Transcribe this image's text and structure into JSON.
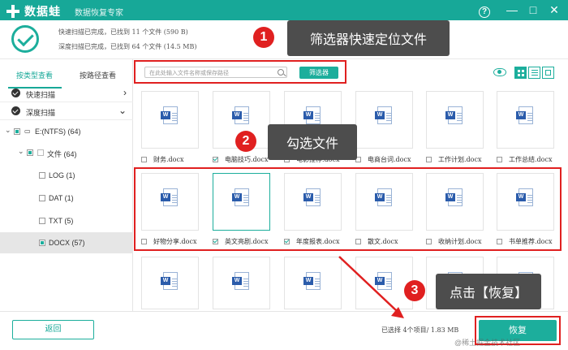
{
  "titlebar": {
    "app_name": "数据蛙",
    "subtitle": "数据恢复专家",
    "help": "?",
    "minimize": "—",
    "maximize": "□",
    "close": "✕"
  },
  "scan": {
    "quick_line": "快速扫描已完成，已找到 11 个文件 (590 B)",
    "deep_line": "深度扫描已完成，已找到 64 个文件 (14.5 MB)"
  },
  "annotations": {
    "badge1": "1",
    "callout1": "筛选器快速定位文件",
    "badge2": "2",
    "callout2": "勾选文件",
    "badge3": "3",
    "callout3": "点击【恢复】",
    "highlight_color": "#e02020"
  },
  "sidebar": {
    "tab_by_type": "按类型查看",
    "tab_by_path": "按路径查看",
    "quick_scan": "快速扫描",
    "quick_scan_arrow": "›",
    "deep_scan": "深度扫描",
    "deep_scan_arrow": "⌄",
    "tree": {
      "drive": "E:(NTFS) (64)",
      "folder": "文件 (64)",
      "items": [
        "LOG (1)",
        "DAT (1)",
        "TXT (5)",
        "DOCX (57)"
      ]
    }
  },
  "toolbar": {
    "search_placeholder": "在此处输入文件名称或保存路径",
    "filter_button": "筛选器"
  },
  "files": {
    "row1": [
      {
        "name": "财务.docx",
        "checked": false
      },
      {
        "name": "电脑技巧.docx",
        "checked": true
      },
      {
        "name": "电影推荐.docx",
        "checked": false
      },
      {
        "name": "电商台词.docx",
        "checked": false
      },
      {
        "name": "工作计划.docx",
        "checked": false
      },
      {
        "name": "工作总结.docx",
        "checked": false
      }
    ],
    "row2": [
      {
        "name": "好物分享.docx",
        "checked": false
      },
      {
        "name": "英文亮剧.docx",
        "checked": true
      },
      {
        "name": "年度报表.docx",
        "checked": true
      },
      {
        "name": "散文.docx",
        "checked": false
      },
      {
        "name": "收纳计划.docx",
        "checked": false
      },
      {
        "name": "书单推荐.docx",
        "checked": false
      }
    ],
    "doc_letter": "W"
  },
  "bottom": {
    "back_button": "返回",
    "selected_status": "已选择 4个项目/ 1.83 MB",
    "recover_button": "恢复",
    "watermark": "@稀土掘金技术社区"
  },
  "colors": {
    "accent": "#1cae9c",
    "titlebar": "#17a898"
  }
}
